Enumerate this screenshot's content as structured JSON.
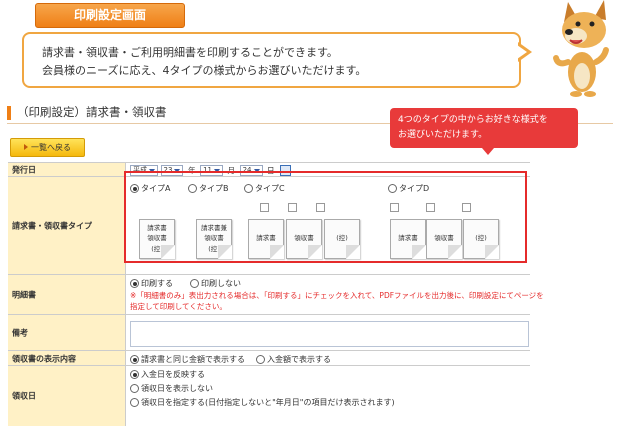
{
  "header_tab": "印刷設定画面",
  "intro": {
    "line1": "請求書・領収書・ご利用明細書を印刷することができます。",
    "line2": "会員様のニーズに応え、4タイプの様式からお選びいただけます。"
  },
  "section_title": "（印刷設定）請求書・領収書",
  "back_button": "一覧へ戻る",
  "callout": {
    "line1": "4つのタイプの中からお好きな様式を",
    "line2": "お選びいただけます。"
  },
  "rows": {
    "issue_date": {
      "label": "発行日",
      "era": "平成",
      "year": "23",
      "year_unit": "年",
      "month": "11",
      "month_unit": "月",
      "day": "24",
      "day_unit": "日"
    },
    "type": {
      "label": "請求書・領収書タイプ",
      "options": [
        {
          "label": "タイプA",
          "selected": true
        },
        {
          "label": "タイプB",
          "selected": false
        },
        {
          "label": "タイプC",
          "selected": false
        },
        {
          "label": "タイプD",
          "selected": false
        }
      ],
      "typeA_doc": [
        "請求書",
        "領収書",
        "(控)"
      ],
      "typeB_doc": [
        "請求書兼",
        "領収書",
        "(控)"
      ],
      "typeC_docs": [
        "請求書",
        "領収書",
        "(控)"
      ],
      "typeD_docs": [
        "請求書",
        "領収書",
        "(控)"
      ]
    },
    "meisai": {
      "label": "明細書",
      "print_on": "印刷する",
      "print_off": "印刷しない",
      "note1": "※「明細書のみ」表出力される場合は、「印刷する」にチェックを入れて、PDFファイルを出力後に、印刷設定にてページを",
      "note2": "指定して印刷してください。"
    },
    "remarks": {
      "label": "備考",
      "value": ""
    },
    "receipt_display": {
      "label": "領収書の表示内容",
      "opt1": "請求書と同じ金額で表示する",
      "opt2": "入金額で表示する"
    },
    "receipt_date": {
      "label": "領収日",
      "opt1": "入金日を反映する",
      "opt2": "領収日を表示しない",
      "opt3": "領収日を指定する(日付指定しないと\"年月日\"の項目だけ表示されます)"
    }
  },
  "colors": {
    "accent": "#ef7f16",
    "callout": "#e83a3a",
    "label_bg": "#fff1c6"
  }
}
